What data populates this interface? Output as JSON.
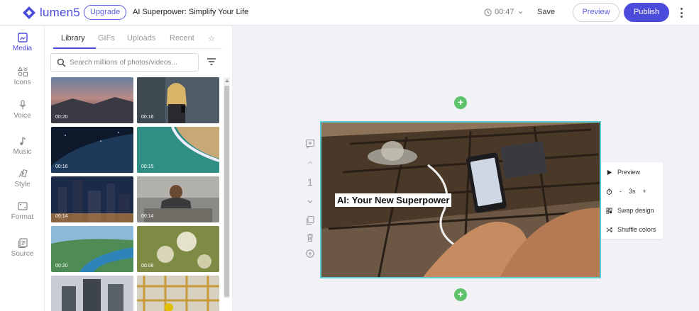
{
  "header": {
    "brand": "lumen5",
    "upgrade_label": "Upgrade",
    "project_title": "AI Superpower: Simplify Your Life",
    "duration": "00:47",
    "save_label": "Save",
    "preview_label": "Preview",
    "publish_label": "Publish",
    "brand_color": "#4b4cdc"
  },
  "rail": {
    "items": [
      {
        "label": "Media",
        "icon": "media-icon",
        "active": true
      },
      {
        "label": "Icons",
        "icon": "icons-icon"
      },
      {
        "label": "Voice",
        "icon": "microphone-icon"
      },
      {
        "label": "Music",
        "icon": "music-note-icon"
      },
      {
        "label": "Style",
        "icon": "style-icon"
      },
      {
        "label": "Format",
        "icon": "format-icon"
      },
      {
        "label": "Source",
        "icon": "source-icon"
      }
    ]
  },
  "panel": {
    "tabs": [
      {
        "label": "Library",
        "active": true
      },
      {
        "label": "GIFs"
      },
      {
        "label": "Uploads"
      },
      {
        "label": "Recent"
      },
      {
        "label": "☆",
        "icon": "star-icon"
      }
    ],
    "search_placeholder": "Search millions of photos/videos...",
    "media": [
      {
        "duration": "00:20"
      },
      {
        "duration": "00:16"
      },
      {
        "duration": "00:16"
      },
      {
        "duration": "00:15"
      },
      {
        "duration": "00:14"
      },
      {
        "duration": "00:14"
      },
      {
        "duration": "00:20"
      },
      {
        "duration": "00:08"
      },
      {
        "duration": ""
      },
      {
        "duration": ""
      }
    ]
  },
  "scene": {
    "number": "1",
    "caption": "AI: Your New Superpower",
    "border_color": "#5fc9d4",
    "add_color": "#5ec26a"
  },
  "context_menu": {
    "preview_label": "Preview",
    "decrease_label": "-",
    "duration_label": "3s",
    "increase_label": "+",
    "swap_label": "Swap design",
    "shuffle_label": "Shuffle colors"
  }
}
